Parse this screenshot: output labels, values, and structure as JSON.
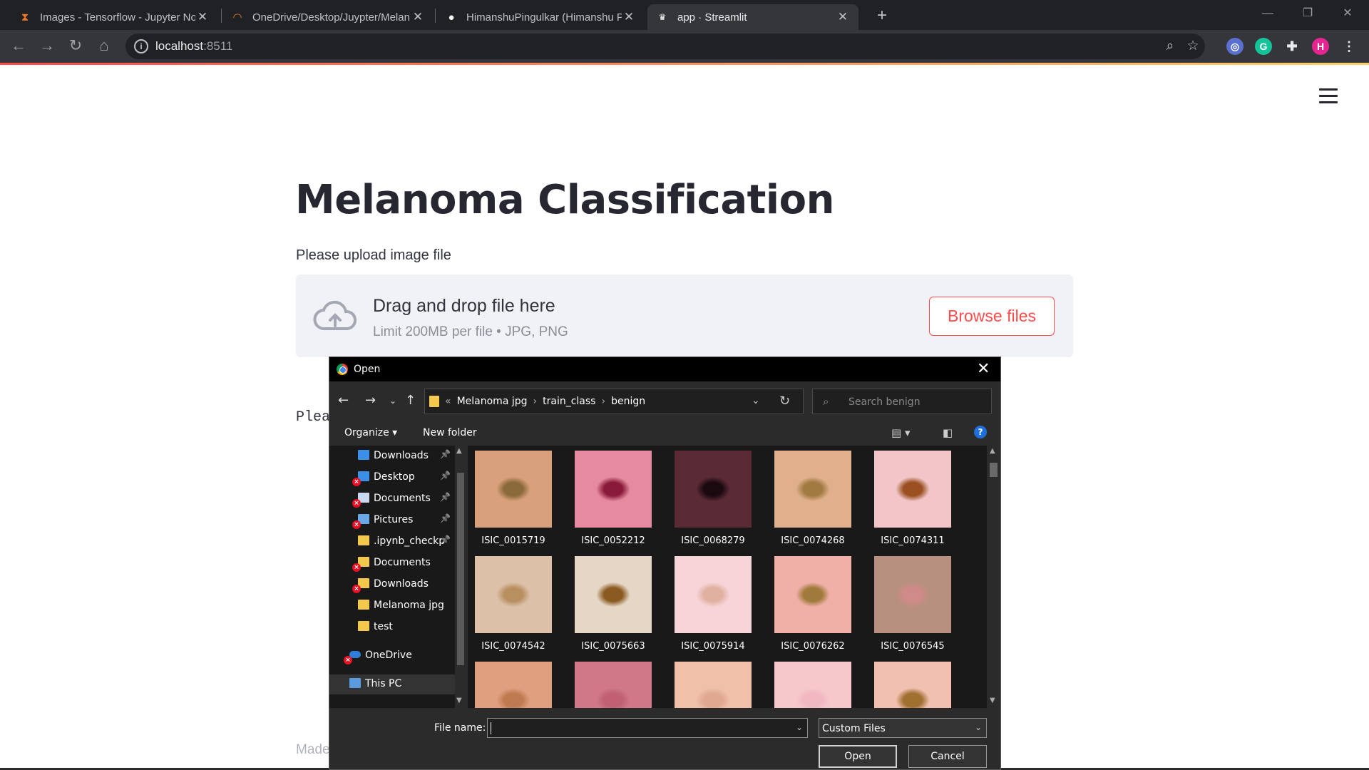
{
  "browser": {
    "tabs": [
      {
        "title": "Images - Tensorflow - Jupyter No",
        "icon": "hourglass-icon",
        "active": false
      },
      {
        "title": "OneDrive/Desktop/Juypter/Melan",
        "icon": "jupyter-icon",
        "active": false
      },
      {
        "title": "HimanshuPingulkar (Himanshu P",
        "icon": "github-icon",
        "active": false
      },
      {
        "title": "app · Streamlit",
        "icon": "streamlit-icon",
        "active": true
      }
    ],
    "url_host": "localhost",
    "url_port": ":8511",
    "profile_initial": "H",
    "colors": {
      "accent": "#ff4b4b",
      "chrome_dark": "#202124",
      "toolbar": "#35363a"
    }
  },
  "page": {
    "title": "Melanoma Classification",
    "upload_label": "Please upload image file",
    "dropzone_title": "Drag and drop file here",
    "dropzone_limit": "Limit 200MB per file • JPG, PNG",
    "browse_label": "Browse files",
    "under_text": "Plea",
    "footer_text": "Made"
  },
  "dialog": {
    "title": "Open",
    "breadcrumb": [
      "Melanoma jpg",
      "train_class",
      "benign"
    ],
    "search_placeholder": "Search benign",
    "organize_label": "Organize ▾",
    "new_folder_label": "New folder",
    "nav_items": [
      {
        "label": "Downloads",
        "icon": "blue",
        "pinned": true,
        "error": false
      },
      {
        "label": "Desktop",
        "icon": "blue",
        "pinned": true,
        "error": true
      },
      {
        "label": "Documents",
        "icon": "doc",
        "pinned": true,
        "error": true
      },
      {
        "label": "Pictures",
        "icon": "pic",
        "pinned": true,
        "error": true
      },
      {
        "label": ".ipynb_checkpoints",
        "icon": "folder",
        "pinned": true,
        "error": false
      },
      {
        "label": "Documents",
        "icon": "folder",
        "pinned": false,
        "error": true
      },
      {
        "label": "Downloads",
        "icon": "folder",
        "pinned": false,
        "error": true
      },
      {
        "label": "Melanoma jpg",
        "icon": "folder",
        "pinned": false,
        "error": false
      },
      {
        "label": "test",
        "icon": "folder",
        "pinned": false,
        "error": false
      },
      {
        "label": "OneDrive",
        "icon": "cloud",
        "pinned": false,
        "error": true
      },
      {
        "label": "This PC",
        "icon": "pc",
        "pinned": false,
        "error": false
      }
    ],
    "files": [
      {
        "name": "ISIC_0015719",
        "bg": "#d9a07c",
        "spot": "#8a6a3a"
      },
      {
        "name": "ISIC_0052212",
        "bg": "#e58aa0",
        "spot": "#8a1a3a"
      },
      {
        "name": "ISIC_0068279",
        "bg": "#5a2a35",
        "spot": "#1a0a10"
      },
      {
        "name": "ISIC_0074268",
        "bg": "#e0b08c",
        "spot": "#a07a40"
      },
      {
        "name": "ISIC_0074311",
        "bg": "#f2c6c8",
        "spot": "#9a5020"
      },
      {
        "name": "ISIC_0074542",
        "bg": "#dcc0a8",
        "spot": "#b89060"
      },
      {
        "name": "ISIC_0075663",
        "bg": "#e6d6c6",
        "spot": "#8a5a20"
      },
      {
        "name": "ISIC_0075914",
        "bg": "#f6d4d8",
        "spot": "#e0b0a0"
      },
      {
        "name": "ISIC_0076262",
        "bg": "#f0b0a8",
        "spot": "#a07a3a"
      },
      {
        "name": "ISIC_0076545",
        "bg": "#b89080",
        "spot": "#d08a88"
      },
      {
        "name": "",
        "bg": "#e0a080",
        "spot": "#c07a50"
      },
      {
        "name": "",
        "bg": "#d07888",
        "spot": "#c06070"
      },
      {
        "name": "",
        "bg": "#f0c0a8",
        "spot": "#e0a890"
      },
      {
        "name": "",
        "bg": "#f6c8cc",
        "spot": "#f0b8c0"
      },
      {
        "name": "",
        "bg": "#f2c0b0",
        "spot": "#a07030"
      }
    ],
    "file_name_label": "File name:",
    "file_name_value": "",
    "file_type": "Custom Files",
    "open_label": "Open",
    "cancel_label": "Cancel"
  }
}
